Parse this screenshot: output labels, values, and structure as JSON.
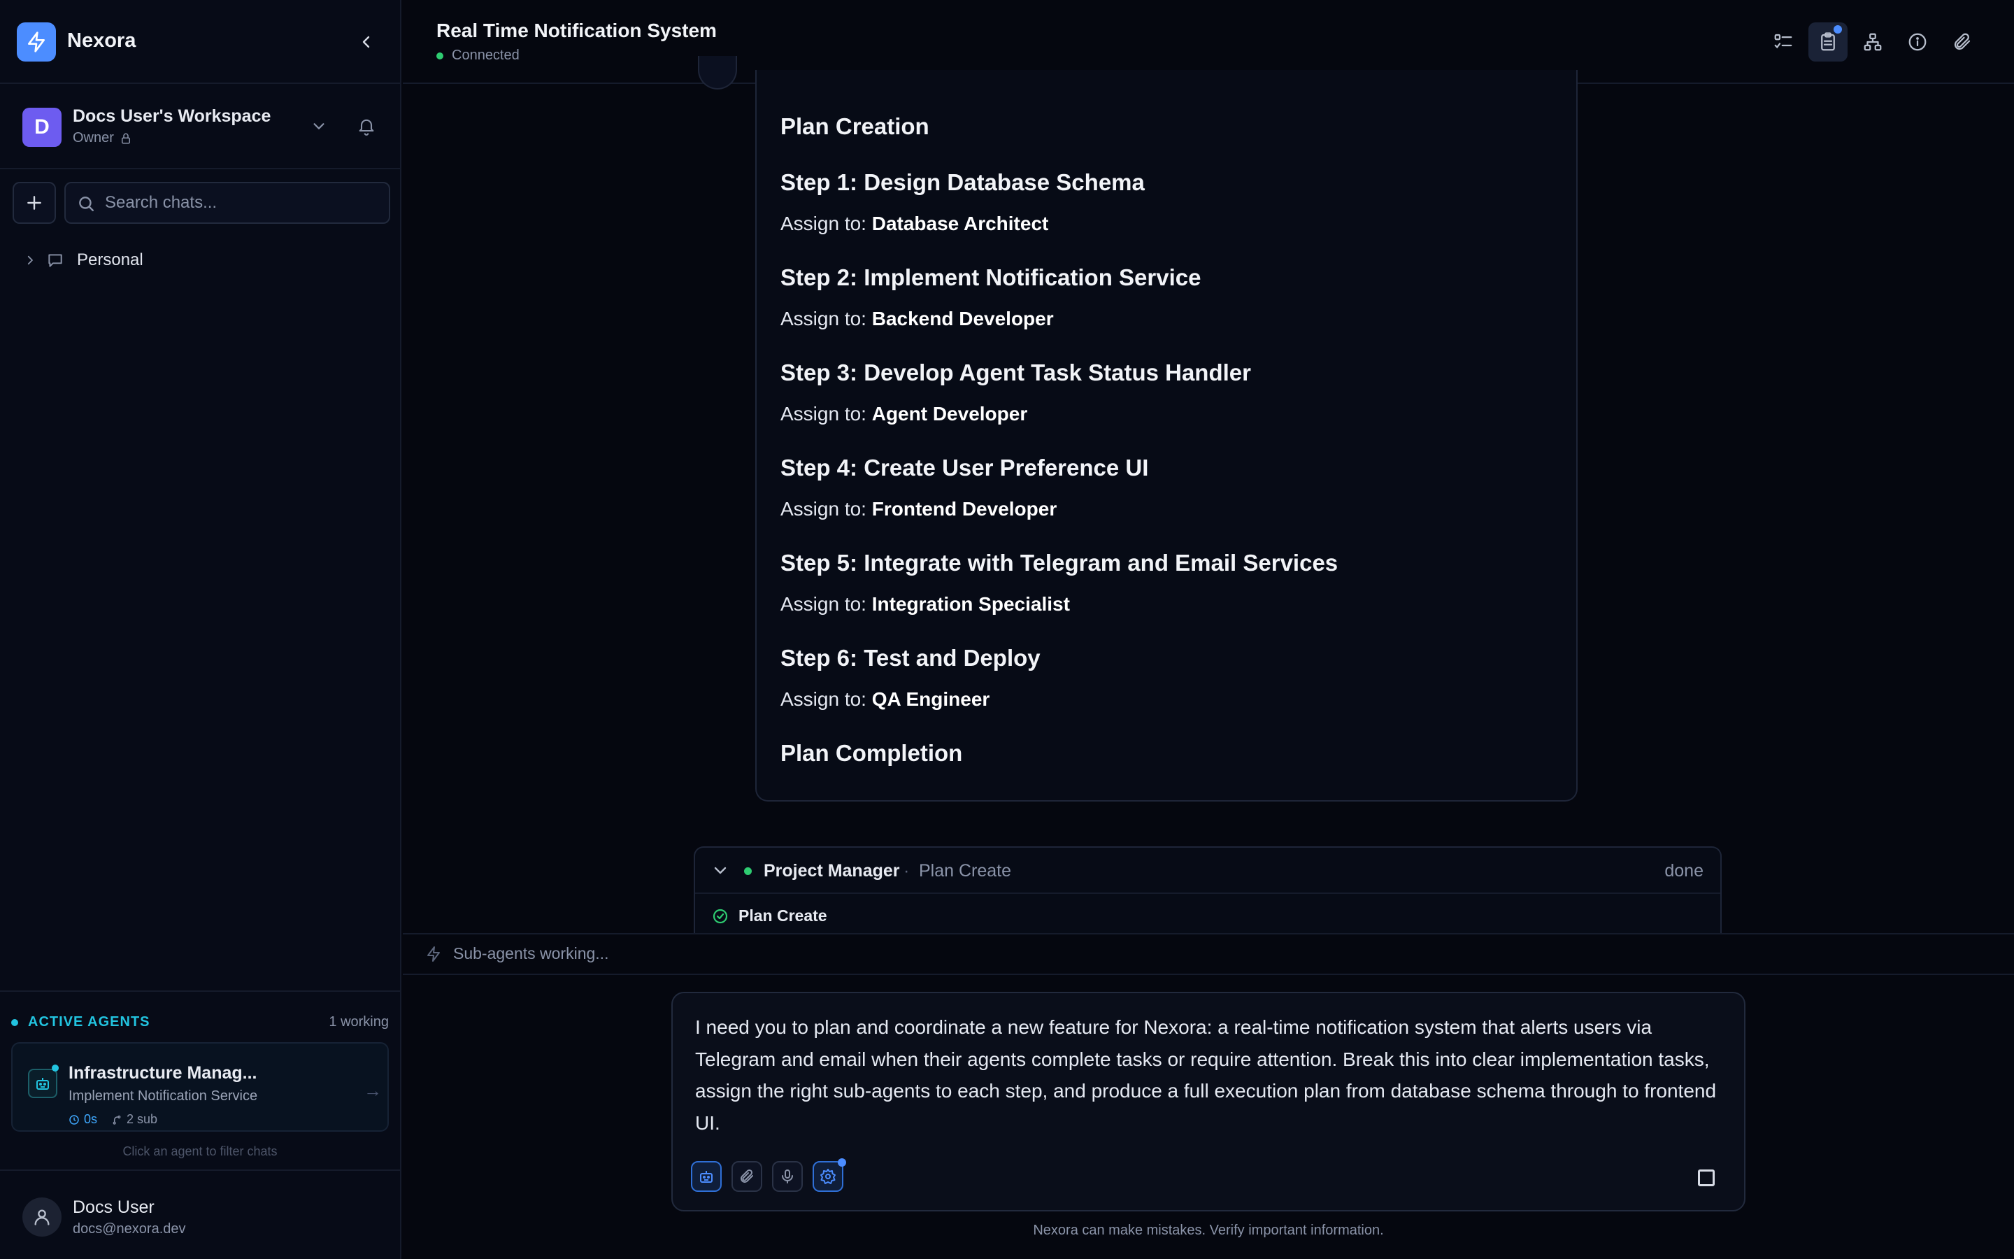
{
  "app": {
    "name": "Nexora"
  },
  "workspace": {
    "initial": "D",
    "name": "Docs User's Workspace",
    "role": "Owner"
  },
  "search": {
    "placeholder": "Search chats..."
  },
  "folders": [
    {
      "label": "Personal"
    }
  ],
  "agents_panel": {
    "title": "ACTIVE AGENTS",
    "count": "1 working",
    "agent": {
      "name": "Infrastructure Manag...",
      "task": "Implement Notification Service",
      "time": "0s",
      "subs": "2 sub"
    },
    "hint": "Click an agent to filter chats"
  },
  "user": {
    "name": "Docs User",
    "email": "docs@nexora.dev"
  },
  "chat": {
    "title": "Real Time Notification System",
    "status": "Connected"
  },
  "toolbar_icons": [
    "checklist-icon",
    "clipboard-icon",
    "hierarchy-icon",
    "info-icon",
    "paperclip-icon"
  ],
  "plan": {
    "heading": "Plan Creation",
    "assign_prefix": "Assign to: ",
    "steps": [
      {
        "title": "Step 1: Design Database Schema",
        "assignee": "Database Architect"
      },
      {
        "title": "Step 2: Implement Notification Service",
        "assignee": "Backend Developer"
      },
      {
        "title": "Step 3: Develop Agent Task Status Handler",
        "assignee": "Agent Developer"
      },
      {
        "title": "Step 4: Create User Preference UI",
        "assignee": "Frontend Developer"
      },
      {
        "title": "Step 5: Integrate with Telegram and Email Services",
        "assignee": "Integration Specialist"
      },
      {
        "title": "Step 6: Test and Deploy",
        "assignee": "QA Engineer"
      }
    ],
    "footer": "Plan Completion"
  },
  "tool_call": {
    "agent": "Project Manager",
    "separator": "·",
    "action": "Plan Create",
    "status": "done",
    "item": "Plan Create"
  },
  "working_status": "Sub-agents working...",
  "composer": {
    "text": "I need you to plan and coordinate a new feature for Nexora: a real-time notification system that alerts users via Telegram and email when their agents complete tasks or require attention. Break this into clear implementation tasks, assign the right sub-agents to each step, and produce a full execution plan from database schema through to frontend UI."
  },
  "disclaimer": "Nexora can make mistakes. Verify important information.",
  "colors": {
    "accent": "#4c8dff",
    "agent_accent": "#22c4e0",
    "online": "#2ecc71",
    "background": "#05070f"
  }
}
